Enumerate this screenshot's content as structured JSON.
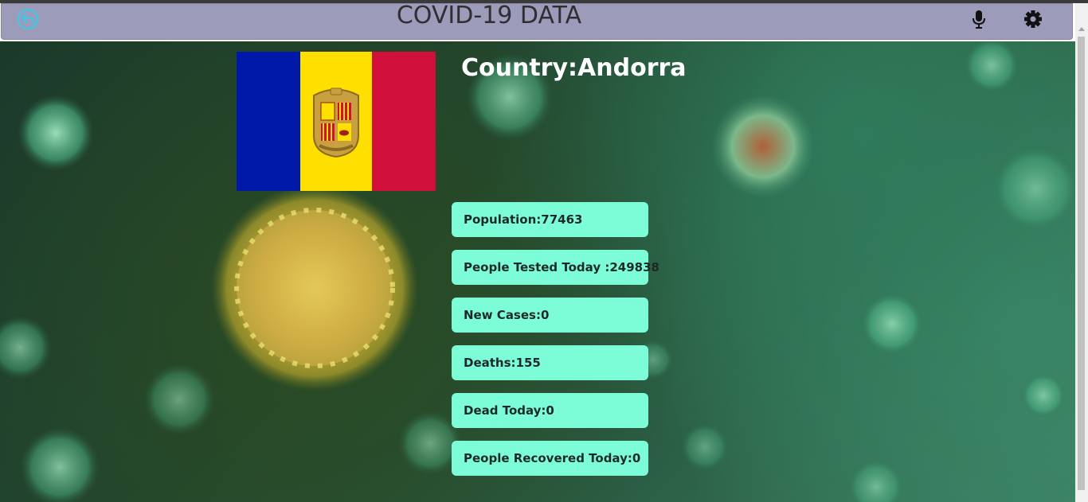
{
  "header": {
    "title": "COVID-19 DATA",
    "back_icon": "back-arrow-icon",
    "mic_icon": "microphone-icon",
    "settings_icon": "gear-icon"
  },
  "country": {
    "label": "Country:Andorra",
    "flag_colors": [
      "#0018a8",
      "#fedf00",
      "#d0103a"
    ]
  },
  "stats": {
    "population": "Population:77463",
    "tested_today": "People Tested Today :249838",
    "new_cases": "New Cases:0",
    "deaths": "Deaths:155",
    "dead_today": "Dead Today:0",
    "recovered_today": "People Recovered Today:0"
  },
  "colors": {
    "header_bg": "#9c9cba",
    "card_bg": "#7dfdd7",
    "back_icon": "#3ec8e6"
  }
}
